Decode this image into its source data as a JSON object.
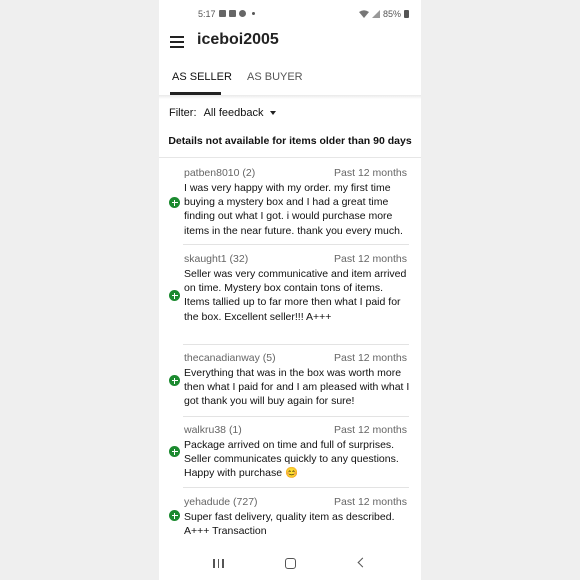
{
  "status_bar": {
    "time": "5:17",
    "battery": "85%"
  },
  "header": {
    "title": "iceboi2005"
  },
  "tabs": [
    {
      "label": "AS SELLER",
      "active": true
    },
    {
      "label": "AS BUYER",
      "active": false
    }
  ],
  "filter": {
    "label": "Filter:",
    "value": "All feedback"
  },
  "notice": "Details not available for items older than 90 days",
  "feedback": [
    {
      "user": "patben8010 (2)",
      "period": "Past 12 months",
      "rating": "positive",
      "comment": "I was very happy with my order. my first time buying a mystery box and I had a great time finding out what I got. i would purchase more items in the near future. thank you every much."
    },
    {
      "user": "skaught1 (32)",
      "period": "Past 12 months",
      "rating": "positive",
      "comment": "Seller was very communicative and item arrived on time. Mystery box contain tons of items. Items tallied up to far more then what I paid for the box. Excellent seller!!! A+++"
    },
    {
      "user": "thecanadianway (5)",
      "period": "Past 12 months",
      "rating": "positive",
      "comment": "Everything that was in the box was worth more then what I paid for and I am pleased with what I got thank you will buy again for sure!"
    },
    {
      "user": "walkru38 (1)",
      "period": "Past 12 months",
      "rating": "positive",
      "comment": "Package arrived on time and full of surprises. Seller communicates quickly to any questions. Happy with purchase 😊"
    },
    {
      "user": "yehadude (727)",
      "period": "Past 12 months",
      "rating": "positive",
      "comment": "Super fast delivery, quality item as described. A+++ Transaction"
    }
  ],
  "icons": {
    "menu": "hamburger-icon",
    "dropdown": "caret-down-icon",
    "positive": "positive-feedback-icon",
    "nav": [
      "recent-apps-icon",
      "home-icon",
      "back-icon"
    ]
  },
  "colors": {
    "positive": "#1b8a2f",
    "active_tab": "#222222"
  }
}
